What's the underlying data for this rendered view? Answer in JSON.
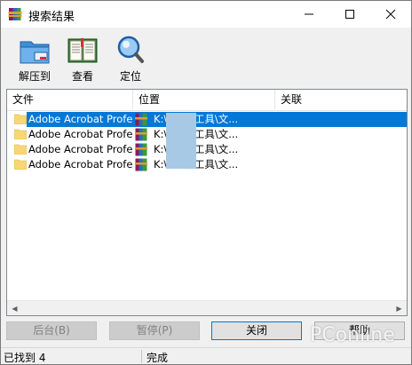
{
  "window": {
    "title": "搜索结果",
    "minimize_glyph": "—",
    "maximize_glyph": "☐",
    "close_glyph": "✕"
  },
  "toolbar": {
    "extract_label": "解压到",
    "view_label": "查看",
    "locate_label": "定位"
  },
  "table": {
    "columns": [
      "文件",
      "位置",
      "关联"
    ],
    "rows": [
      {
        "file": "Adobe Acrobat Profe...",
        "location": "K:\\          \\系统工具\\文...",
        "assoc": "",
        "selected": true
      },
      {
        "file": "Adobe Acrobat Profe...",
        "location": "K:\\          \\系统工具\\文...",
        "assoc": "",
        "selected": false
      },
      {
        "file": "Adobe Acrobat Profe...",
        "location": "K:\\          \\系统工具\\文...",
        "assoc": "",
        "selected": false
      },
      {
        "file": "Adobe Acrobat Profe...",
        "location": "K:\\          \\系统工具\\文...",
        "assoc": "",
        "selected": false
      }
    ]
  },
  "buttons": {
    "background_label": "后台(B)",
    "pause_label": "暂停(P)",
    "close_label": "关闭",
    "help_label": "帮助"
  },
  "status": {
    "found": "已找到 4",
    "state": "完成"
  },
  "watermark": "PConline",
  "colors": {
    "selection": "#0078d7",
    "disabled_button": "#cccccc"
  }
}
